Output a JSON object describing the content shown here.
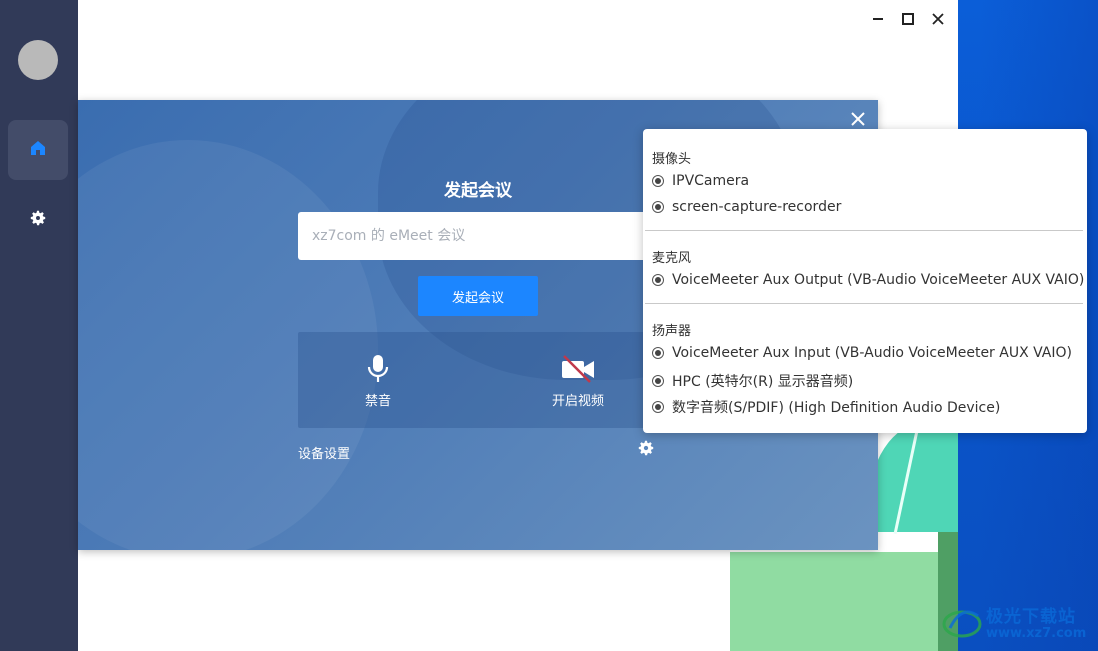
{
  "colors": {
    "sidebar": "#313a58",
    "modal_accent": "#1c86ff",
    "desktop": "#0b5ed8"
  },
  "sidebar": {
    "items": [
      {
        "icon": "home-icon",
        "active": true
      },
      {
        "icon": "gear-icon",
        "active": false
      }
    ]
  },
  "window_controls": [
    "minimize-icon",
    "maximize-icon",
    "close-icon"
  ],
  "modal": {
    "title": "发起会议",
    "input_placeholder": "xz7com 的 eMeet 会议",
    "start_button": "发起会议",
    "mute_label": "禁音",
    "video_label": "开启视频",
    "device_settings_label": "设备设置"
  },
  "device_menu": {
    "camera": {
      "title": "摄像头",
      "options": [
        "IPVCamera",
        "screen-capture-recorder"
      ]
    },
    "microphone": {
      "title": "麦克风",
      "options": [
        "VoiceMeeter Aux Output (VB-Audio VoiceMeeter AUX VAIO)"
      ]
    },
    "speaker": {
      "title": "扬声器",
      "options": [
        "VoiceMeeter Aux Input (VB-Audio VoiceMeeter AUX VAIO)",
        "HPC (英特尔(R) 显示器音频)",
        "数字音频(S/PDIF) (High Definition Audio Device)"
      ]
    }
  },
  "watermark": {
    "text": "极光下载站",
    "url": "www.xz7.com"
  }
}
